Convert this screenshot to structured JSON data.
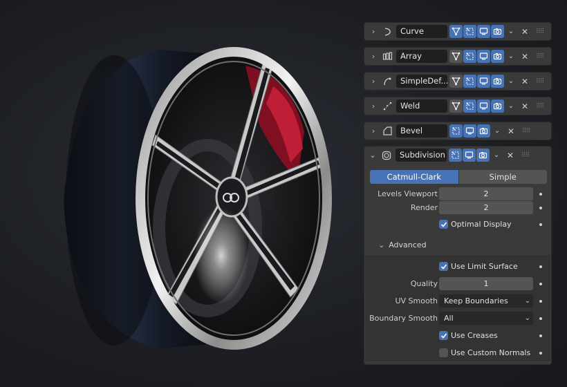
{
  "modifiers": [
    {
      "name": "Curve",
      "icon": "curve-modifier-icon",
      "toggles": [
        "editmode-on",
        "cage-on",
        "realtime-on",
        "render-on"
      ]
    },
    {
      "name": "Array",
      "icon": "array-modifier-icon",
      "toggles": [
        "editmode-off",
        "cage-on",
        "realtime-on",
        "render-on"
      ]
    },
    {
      "name": "SimpleDef...",
      "icon": "simpledeform-modifier-icon",
      "toggles": [
        "editmode-off",
        "cage-on",
        "realtime-on",
        "render-on"
      ]
    },
    {
      "name": "Weld",
      "icon": "weld-modifier-icon",
      "toggles": [
        "editmode-off",
        "cage-on",
        "realtime-on",
        "render-on"
      ]
    },
    {
      "name": "Bevel",
      "icon": "bevel-modifier-icon",
      "toggles": [
        "cage-on",
        "realtime-on",
        "render-on"
      ]
    }
  ],
  "subdivision": {
    "name": "Subdivision",
    "icon": "subdivision-modifier-icon",
    "mode_catmull": "Catmull-Clark",
    "mode_simple": "Simple",
    "levels_viewport_label": "Levels Viewport",
    "levels_viewport_value": "2",
    "render_label": "Render",
    "render_value": "2",
    "optimal_display_label": "Optimal Display",
    "optimal_display_checked": true,
    "advanced_label": "Advanced",
    "use_limit_surface_label": "Use Limit Surface",
    "use_limit_surface_checked": true,
    "quality_label": "Quality",
    "quality_value": "1",
    "uv_smooth_label": "UV Smooth",
    "uv_smooth_value": "Keep Boundaries",
    "boundary_smooth_label": "Boundary Smooth",
    "boundary_smooth_value": "All",
    "use_creases_label": "Use Creases",
    "use_creases_checked": true,
    "use_custom_normals_label": "Use Custom Normals",
    "use_custom_normals_checked": false
  },
  "colors": {
    "accent": "#4772b3",
    "panel": "#3a3a3a",
    "field": "#545454",
    "brake_caliper": "#b0142a"
  }
}
